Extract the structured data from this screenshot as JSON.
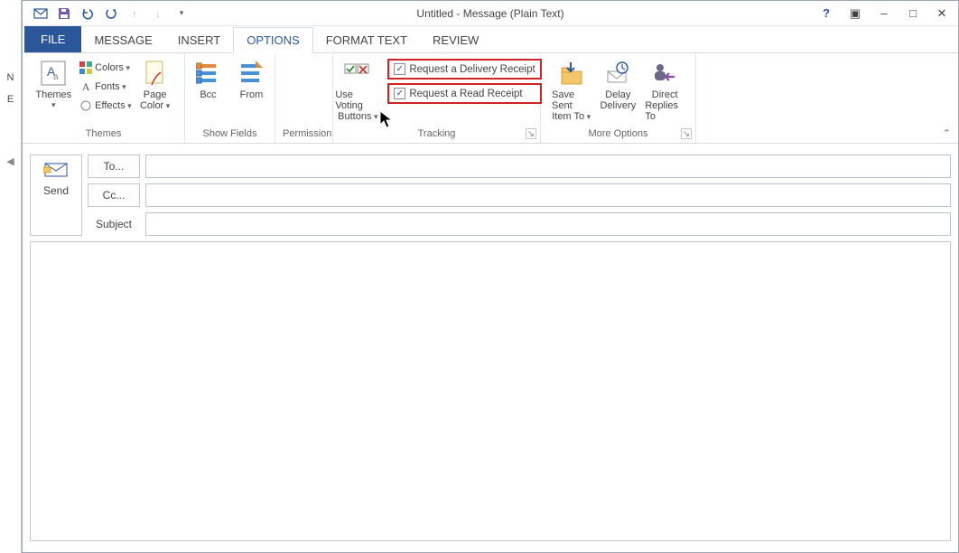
{
  "window": {
    "title": "Untitled - Message (Plain Text)"
  },
  "qat": {
    "dropdown": "▾"
  },
  "winbuttons": {
    "help": "?",
    "full": "▣",
    "min": "–",
    "max": "□",
    "close": "✕"
  },
  "tabs": {
    "file": "FILE",
    "message": "MESSAGE",
    "insert": "INSERT",
    "options": "OPTIONS",
    "format_text": "FORMAT TEXT",
    "review": "REVIEW"
  },
  "ribbon": {
    "themes": {
      "themes": "Themes",
      "colors": "Colors",
      "fonts": "Fonts",
      "effects": "Effects",
      "page_color_l1": "Page",
      "page_color_l2": "Color",
      "group": "Themes"
    },
    "showfields": {
      "bcc": "Bcc",
      "from": "From",
      "group": "Show Fields"
    },
    "permission": {
      "group": "Permission"
    },
    "tracking": {
      "voting_l1": "Use Voting",
      "voting_l2": "Buttons",
      "delivery_receipt": "Request a Delivery Receipt",
      "read_receipt": "Request a Read Receipt",
      "group": "Tracking"
    },
    "moreoptions": {
      "savesent_l1": "Save Sent",
      "savesent_l2": "Item To",
      "delay_l1": "Delay",
      "delay_l2": "Delivery",
      "direct_l1": "Direct",
      "direct_l2": "Replies To",
      "group": "More Options"
    }
  },
  "compose": {
    "send": "Send",
    "to_btn": "To...",
    "cc_btn": "Cc...",
    "subject_label": "Subject",
    "to_value": "",
    "cc_value": "",
    "subject_value": "",
    "body_value": ""
  },
  "left_sliver": {
    "r1": "N",
    "r2": "E",
    "arrow": "◀"
  }
}
